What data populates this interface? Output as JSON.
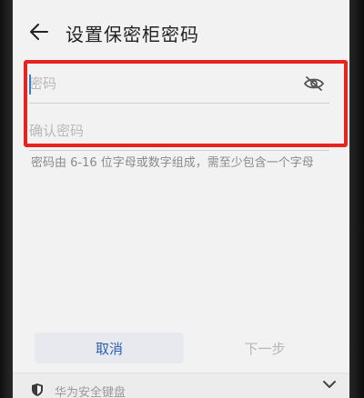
{
  "header": {
    "title": "设置保密柜密码"
  },
  "form": {
    "password_placeholder": "密码",
    "confirm_placeholder": "确认密码",
    "hint": "密码由 6-16 位字母或数字组成，需至少包含一个字母"
  },
  "actions": {
    "cancel_label": "取消",
    "next_label": "下一步"
  },
  "keyboard": {
    "label": "华为安全键盘"
  },
  "colors": {
    "highlight": "#e8221d",
    "accent": "#2b5fb5",
    "disabled": "#b7b7b7"
  },
  "icons": [
    "back-arrow-icon",
    "eye-hidden-icon",
    "shield-icon",
    "chevron-down-icon"
  ]
}
